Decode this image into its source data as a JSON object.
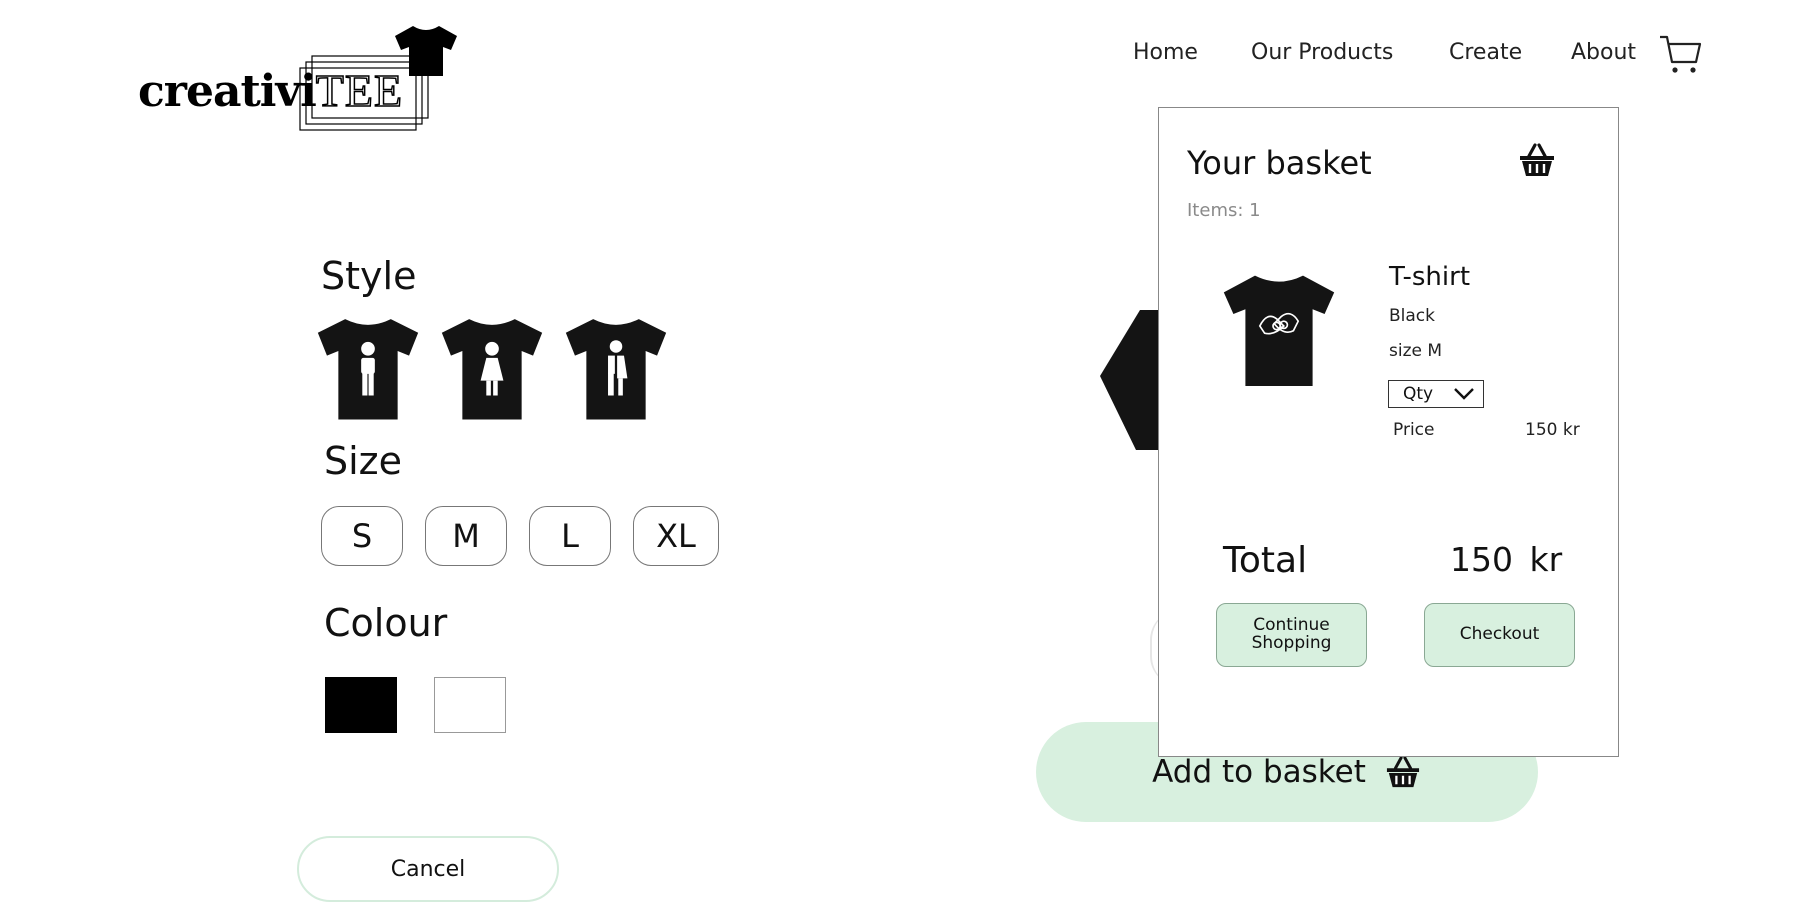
{
  "brand": {
    "logo_main": "creativi",
    "logo_accent": "TEE"
  },
  "nav": {
    "items": [
      "Home",
      "Our Products",
      "Create",
      "About"
    ],
    "cart_icon": "shopping-cart-icon"
  },
  "customizer": {
    "style_heading": "Style",
    "styles": [
      "male",
      "female",
      "unisex"
    ],
    "size_heading": "Size",
    "sizes": [
      "S",
      "M",
      "L",
      "XL"
    ],
    "colour_heading": "Colour",
    "colours": [
      "#000000",
      "#ffffff"
    ],
    "cancel_label": "Cancel",
    "add_to_basket_label": "Add to basket"
  },
  "basket": {
    "title": "Your basket",
    "items_count": "Items: 1",
    "item": {
      "name": "T-shirt",
      "colour": "Black",
      "size": "size M",
      "qty_label": "Qty",
      "price_label": "Price",
      "price_value": "150 kr"
    },
    "total_label": "Total",
    "total_value": "150  kr",
    "continue_label": "Continue Shopping",
    "checkout_label": "Checkout"
  },
  "colors": {
    "accent_green": "#d8f0df",
    "text": "#111111",
    "muted": "#8a8a8a"
  }
}
